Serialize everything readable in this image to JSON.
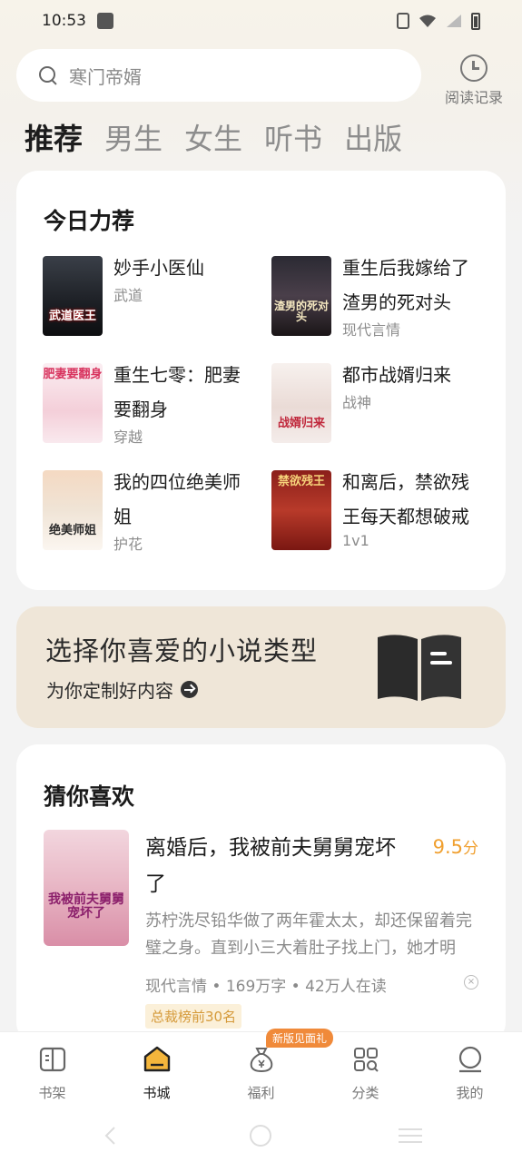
{
  "status_bar": {
    "time": "10:53"
  },
  "search": {
    "placeholder": "寒门帝婿"
  },
  "history": {
    "label": "阅读记录"
  },
  "tabs": [
    {
      "label": "推荐",
      "active": true
    },
    {
      "label": "男生"
    },
    {
      "label": "女生"
    },
    {
      "label": "听书"
    },
    {
      "label": "出版"
    }
  ],
  "today_recommend": {
    "title": "今日力荐",
    "books": [
      {
        "title": "妙手小医仙",
        "tag": "武道",
        "cover_text": "武道医王"
      },
      {
        "title": "重生后我嫁给了渣男的死对头",
        "tag": "现代言情",
        "cover_text": "渣男的死对头"
      },
      {
        "title": "重生七零：肥妻要翻身",
        "tag": "穿越",
        "cover_text": "肥妻要翻身"
      },
      {
        "title": "都市战婿归来",
        "tag": "战神",
        "cover_text": "战婿归来"
      },
      {
        "title": "我的四位绝美师姐",
        "tag": "护花",
        "cover_text": "绝美师姐"
      },
      {
        "title": "和离后，禁欲残王每天都想破戒",
        "tag": "1v1",
        "cover_text": "禁欲残王"
      }
    ]
  },
  "banner": {
    "title": "选择你喜爱的小说类型",
    "subtitle": "为你定制好内容"
  },
  "guess": {
    "title": "猜你喜欢",
    "book": {
      "title": "离婚后，我被前夫舅舅宠坏了",
      "score": "9.5",
      "score_unit": "分",
      "desc": "苏柠洗尽铅华做了两年霍太太，却还保留着完璧之身。直到小三大着肚子找上门，她才明白...",
      "meta": "现代言情 • 169万字 • 42万人在读",
      "rank": "总裁榜前30名",
      "cover_text": "我被前夫舅舅宠坏了"
    }
  },
  "bottom_nav": {
    "items": [
      {
        "label": "书架"
      },
      {
        "label": "书城"
      },
      {
        "label": "福利"
      },
      {
        "label": "分类"
      },
      {
        "label": "我的"
      }
    ],
    "promo": "新版见面礼"
  }
}
